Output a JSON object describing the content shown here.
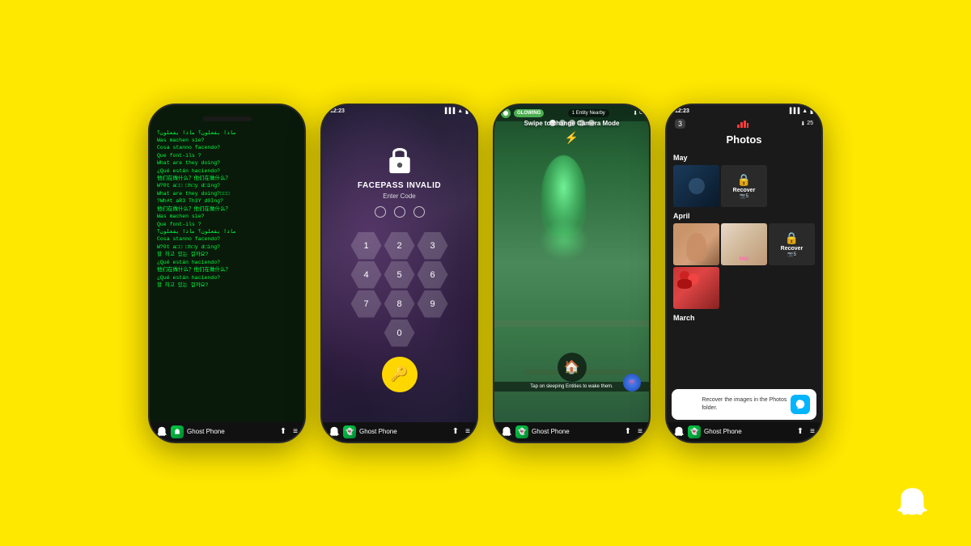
{
  "background_color": "#FFE800",
  "phones": [
    {
      "id": "phone1",
      "name": "matrix-phone",
      "screen_type": "matrix",
      "matrix_lines": [
        "ماذا يفعلون؟ ماذا يفعلون؟",
        "Was machen sie?",
        "Cosa stanno facendo?",
        "Que font-ils ?",
        "What are they doing?",
        "¿Qué están haciendo?",
        "他们在做什么？他们在做什么？",
        "W?0t a00 0h0y d0ing?",
        "What are they doing?000",
        "?Wh#t aR3 Th3Y d0Ing?",
        "他们在做什么？他们在做什么？",
        "Was machen sie?",
        "Que font-ils ?",
        "ماذا يفعلون؟ ماذا يفعلون؟",
        "Cosa stanno facendo?",
        "W?0t a00 0h0y d0ing?",
        "할 하고 있는 걸까요?",
        "¿Qué están haciendo?他们在做什么？",
        "他们在做什么？他们在做什么？",
        "¿Qué están haciendo?",
        "할 하고 있는 걸까요?"
      ],
      "bottom_bar": {
        "app_name": "Ghost Phone",
        "icons": [
          "share",
          "menu"
        ]
      }
    },
    {
      "id": "phone2",
      "name": "facepass-phone",
      "screen_type": "facepass",
      "status_time": "12:23",
      "title": "FACEPASS INVALID",
      "subtitle": "Enter Code",
      "keypad": [
        "1",
        "2",
        "3",
        "4",
        "5",
        "6",
        "7",
        "8",
        "9",
        "0"
      ],
      "bottom_bar": {
        "app_name": "Ghost Phone"
      }
    },
    {
      "id": "phone3",
      "name": "ar-ghost-phone",
      "screen_type": "ar_ghost",
      "status_label": "GLOWING",
      "entity_label": "1 Entity Nearby",
      "camera_mode_text": "Swipe to change Camera Mode",
      "bottom_tip": "Tap on sleeping Entities to wake them.",
      "bottom_bar": {
        "app_name": "Ghost Phone"
      }
    },
    {
      "id": "phone4",
      "name": "photos-phone",
      "screen_type": "photos",
      "status_time": "12:23",
      "title": "Photos",
      "counter_left": "3",
      "counter_right": "25",
      "sections": [
        {
          "month": "May",
          "photos": [
            "dark",
            "recover"
          ],
          "recover_label": "Recover",
          "recover_count": "🔒5"
        },
        {
          "month": "April",
          "photos": [
            "person",
            "group",
            "recover",
            "fruit"
          ],
          "recover_label": "Recover",
          "recover_count": "🔒5"
        },
        {
          "month": "March",
          "photos": []
        }
      ],
      "recovery_banner": "Recover the images in the Photos folder.",
      "bottom_bar": {
        "app_name": "Ghost Phone"
      }
    }
  ],
  "snapchat_logo": {
    "visible": true,
    "alt": "Snapchat ghost logo"
  }
}
